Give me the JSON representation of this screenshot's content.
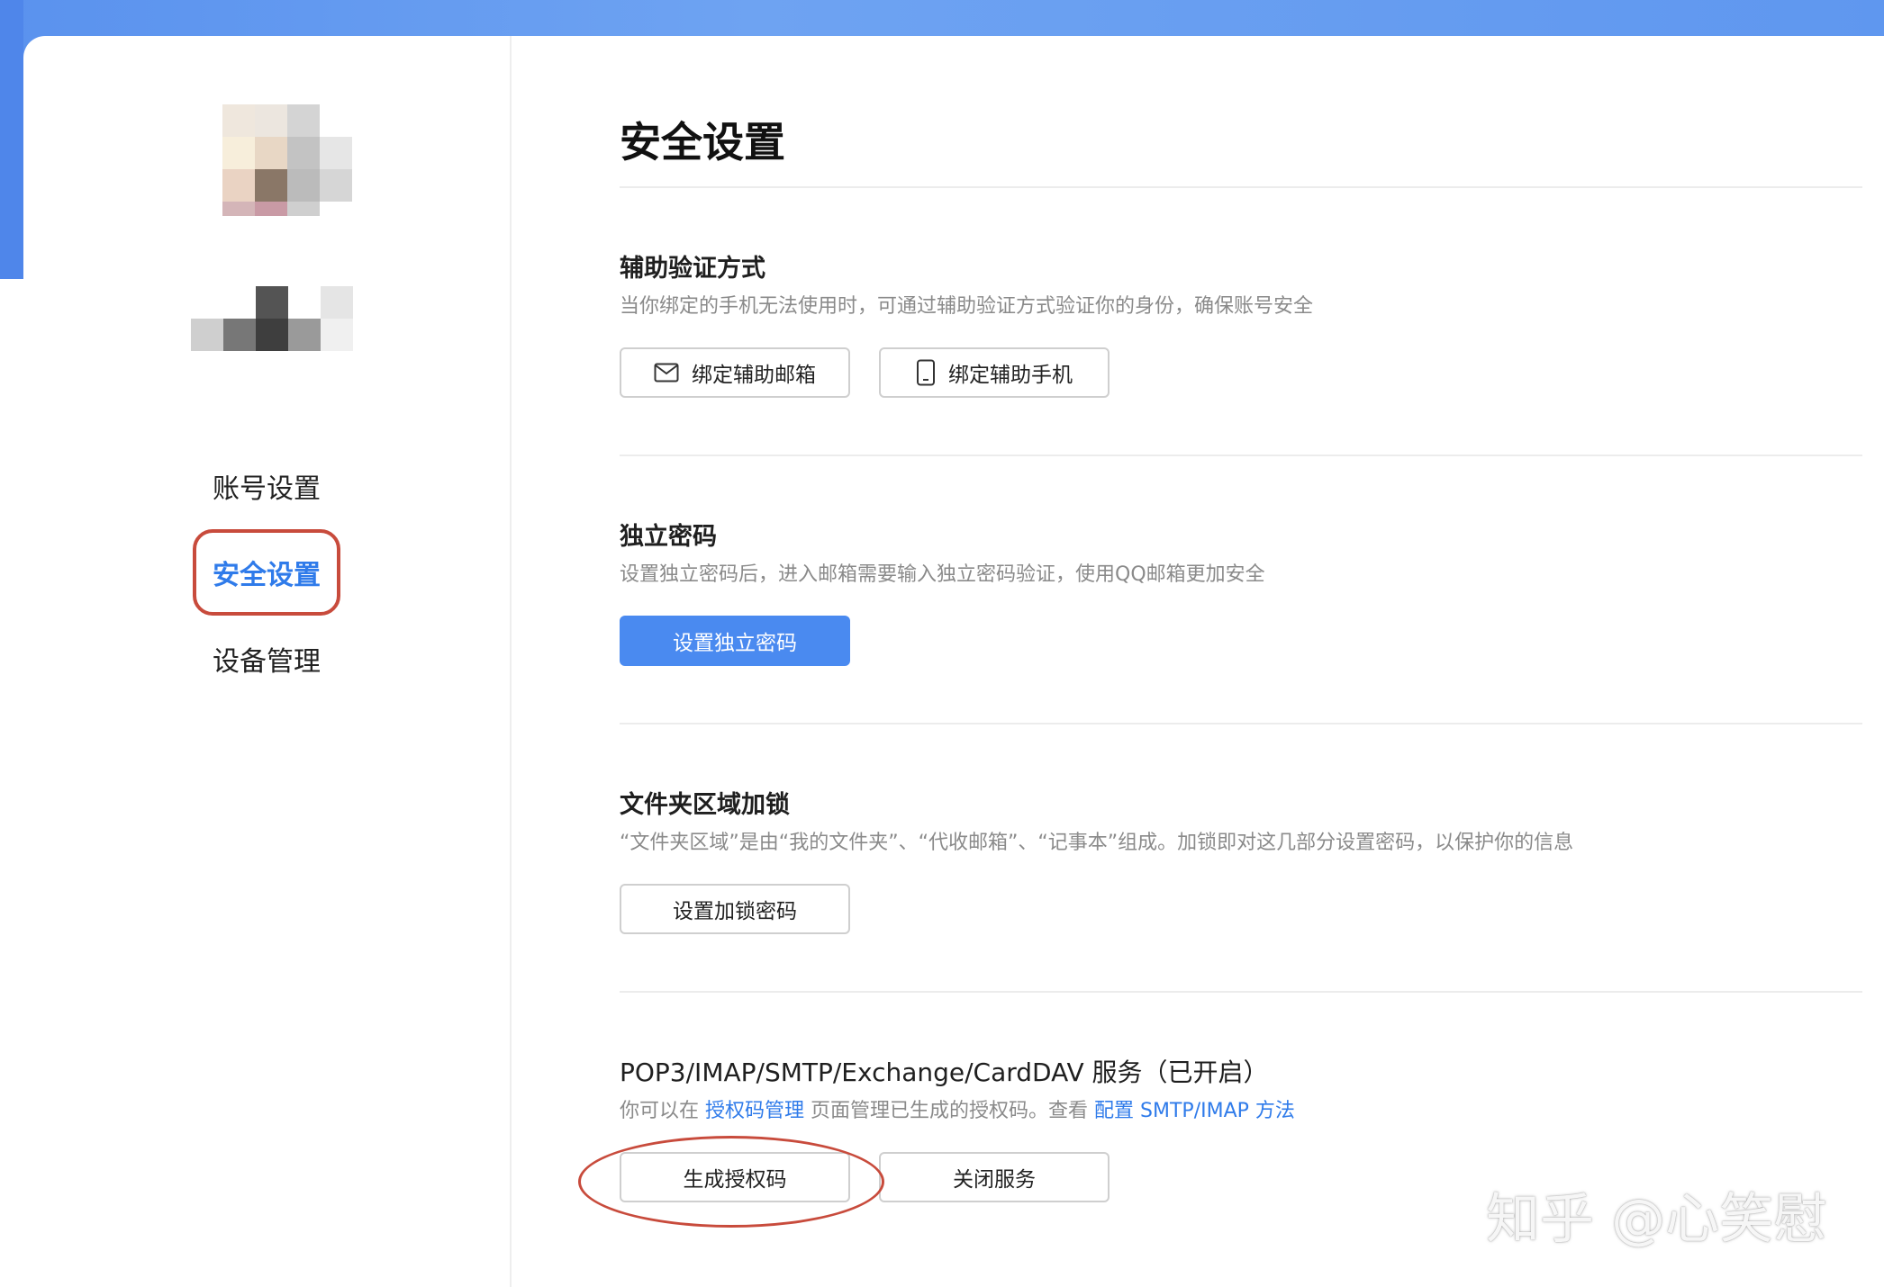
{
  "page_title": "安全设置",
  "sidebar": {
    "items": [
      {
        "label": "账号设置"
      },
      {
        "label": "安全设置",
        "active": true
      },
      {
        "label": "设备管理"
      }
    ]
  },
  "sections": {
    "aux_verify": {
      "title": "辅助验证方式",
      "desc": "当你绑定的手机无法使用时，可通过辅助验证方式验证你的身份，确保账号安全",
      "buttons": {
        "email": {
          "label": "绑定辅助邮箱",
          "icon": "mail-icon"
        },
        "phone": {
          "label": "绑定辅助手机",
          "icon": "phone-icon"
        }
      }
    },
    "independent_password": {
      "title": "独立密码",
      "desc": "设置独立密码后，进入邮箱需要输入独立密码验证，使用QQ邮箱更加安全",
      "button": {
        "label": "设置独立密码"
      }
    },
    "folder_lock": {
      "title": "文件夹区域加锁",
      "desc": "“文件夹区域”是由“我的文件夹”、“代收邮箱”、“记事本”组成。加锁即对这几部分设置密码，以保护你的信息",
      "button": {
        "label": "设置加锁密码"
      }
    },
    "pop3": {
      "title": "POP3/IMAP/SMTP/Exchange/CardDAV 服务（已开启）",
      "desc_prefix": "你可以在",
      "desc_link1": "授权码管理",
      "desc_mid": "页面管理已生成的授权码。查看",
      "desc_link2": "配置 SMTP/IMAP 方法",
      "buttons": {
        "generate": {
          "label": "生成授权码"
        },
        "close": {
          "label": "关闭服务"
        }
      }
    }
  },
  "watermark": "知乎 @心笑慰",
  "colors": {
    "accent": "#2f7bea",
    "primary_button": "#4a8af0",
    "highlight": "#c84b3c",
    "header_bg": "#5f97ef"
  }
}
